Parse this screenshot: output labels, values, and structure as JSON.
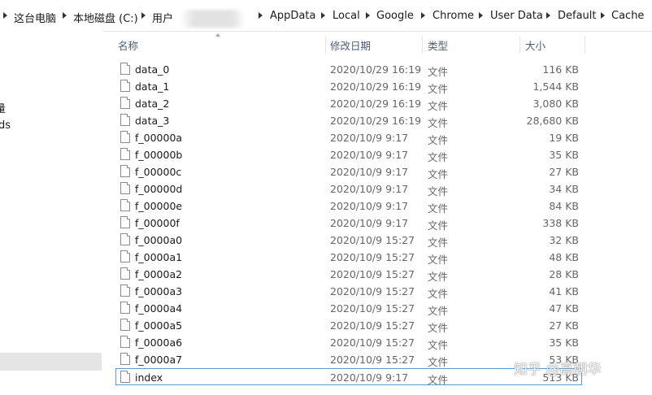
{
  "breadcrumb": {
    "segments": [
      "这台电脑",
      "本地磁盘 (C:)",
      "用户",
      "AppData",
      "Local",
      "Google",
      "Chrome",
      "User Data",
      "Default",
      "Cache"
    ]
  },
  "nav": {
    "fragments": [
      "量",
      "ds"
    ]
  },
  "columns": {
    "name": "名称",
    "date": "修改日期",
    "type": "类型",
    "size": "大小"
  },
  "files": [
    {
      "name": "data_0",
      "date": "2020/10/29 16:19",
      "type": "文件",
      "size": "116 KB"
    },
    {
      "name": "data_1",
      "date": "2020/10/29 16:19",
      "type": "文件",
      "size": "1,544 KB"
    },
    {
      "name": "data_2",
      "date": "2020/10/29 16:19",
      "type": "文件",
      "size": "3,080 KB"
    },
    {
      "name": "data_3",
      "date": "2020/10/29 16:19",
      "type": "文件",
      "size": "28,680 KB"
    },
    {
      "name": "f_00000a",
      "date": "2020/10/9 9:17",
      "type": "文件",
      "size": "19 KB"
    },
    {
      "name": "f_00000b",
      "date": "2020/10/9 9:17",
      "type": "文件",
      "size": "35 KB"
    },
    {
      "name": "f_00000c",
      "date": "2020/10/9 9:17",
      "type": "文件",
      "size": "27 KB"
    },
    {
      "name": "f_00000d",
      "date": "2020/10/9 9:17",
      "type": "文件",
      "size": "34 KB"
    },
    {
      "name": "f_00000e",
      "date": "2020/10/9 9:17",
      "type": "文件",
      "size": "84 KB"
    },
    {
      "name": "f_00000f",
      "date": "2020/10/9 9:17",
      "type": "文件",
      "size": "338 KB"
    },
    {
      "name": "f_0000a0",
      "date": "2020/10/9 15:27",
      "type": "文件",
      "size": "32 KB"
    },
    {
      "name": "f_0000a1",
      "date": "2020/10/9 15:27",
      "type": "文件",
      "size": "48 KB"
    },
    {
      "name": "f_0000a2",
      "date": "2020/10/9 15:27",
      "type": "文件",
      "size": "28 KB"
    },
    {
      "name": "f_0000a3",
      "date": "2020/10/9 15:27",
      "type": "文件",
      "size": "41 KB"
    },
    {
      "name": "f_0000a4",
      "date": "2020/10/9 15:27",
      "type": "文件",
      "size": "47 KB"
    },
    {
      "name": "f_0000a5",
      "date": "2020/10/9 15:27",
      "type": "文件",
      "size": "27 KB"
    },
    {
      "name": "f_0000a6",
      "date": "2020/10/9 15:27",
      "type": "文件",
      "size": "35 KB"
    },
    {
      "name": "f_0000a7",
      "date": "2020/10/9 15:27",
      "type": "文件",
      "size": "53 KB"
    },
    {
      "name": "index",
      "date": "2020/10/9 9:17",
      "type": "文件",
      "size": "513 KB"
    }
  ],
  "selected_file": "index",
  "watermark": "知乎 @高朝华"
}
